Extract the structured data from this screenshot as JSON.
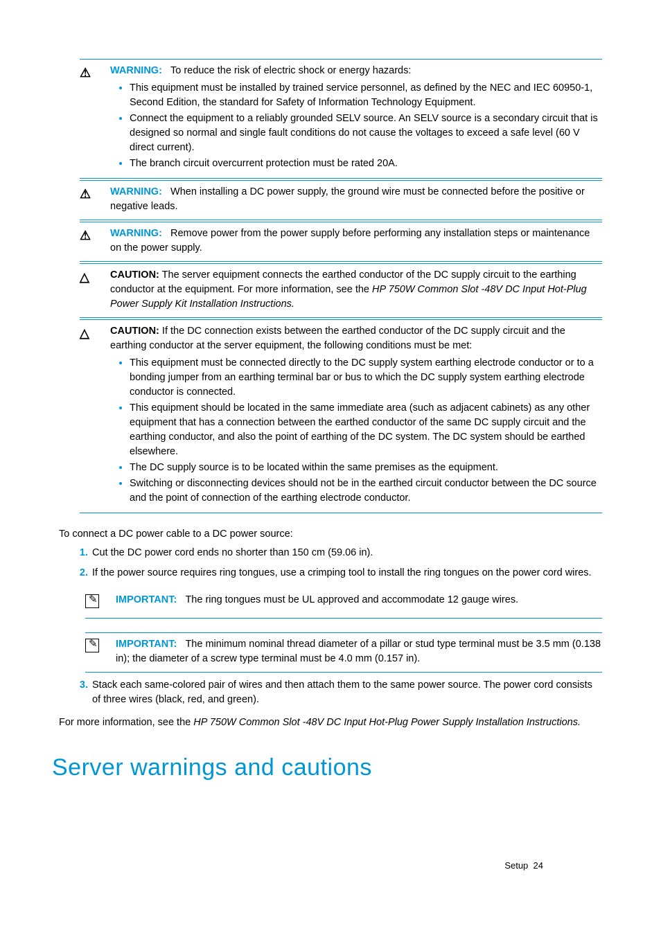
{
  "notices": [
    {
      "label": "WARNING:",
      "intro": "To reduce the risk of electric shock or energy hazards:",
      "bullets": [
        "This equipment must be installed by trained service personnel, as defined by the NEC and IEC 60950-1, Second Edition, the standard for Safety of Information Technology Equipment.",
        "Connect the equipment to a reliably grounded SELV source. An SELV source is a secondary circuit that is designed so normal and single fault conditions do not cause the voltages to exceed a safe level (60 V direct current).",
        "The branch circuit overcurrent protection must be rated 20A."
      ]
    },
    {
      "label": "WARNING:",
      "text": "When installing a DC power supply, the ground wire must be connected before the positive or negative leads."
    },
    {
      "label": "WARNING:",
      "text": "Remove power from the power supply before performing any installation steps or maintenance on the power supply."
    },
    {
      "label": "CAUTION:",
      "text_pre": "The server equipment connects the earthed conductor of the DC supply circuit to the earthing conductor at the equipment. For more information, see the ",
      "text_italic": "HP 750W Common Slot -48V DC Input Hot-Plug Power Supply Kit Installation Instructions.",
      "black": true
    },
    {
      "label": "CAUTION:",
      "intro": "If the DC connection exists between the earthed conductor of the DC supply circuit and the earthing conductor at the server equipment, the following conditions must be met:",
      "black": true,
      "bullets": [
        "This equipment must be connected directly to the DC supply system earthing electrode conductor or to a bonding jumper from an earthing terminal bar or bus to which the DC supply system earthing electrode conductor is connected.",
        "This equipment should be located in the same immediate area (such as adjacent cabinets) as any other equipment that has a connection between the earthed conductor of the same DC supply circuit and the earthing conductor, and also the point of earthing of the DC system. The DC system should be earthed elsewhere.",
        "The DC supply source is to be located within the same premises as the equipment.",
        "Switching or disconnecting devices should not be in the earthed circuit conductor between the DC source and the point of connection of the earthing electrode conductor."
      ]
    }
  ],
  "steps_intro": "To connect a DC power cable to a DC power source:",
  "steps": {
    "s1": "Cut the DC power cord ends no shorter than 150 cm (59.06 in).",
    "s2": "If the power source requires ring tongues, use a crimping tool to install the ring tongues on the power cord wires.",
    "s3": "Stack each same-colored pair of wires and then attach them to the same power source. The power cord consists of three wires (black, red, and green)."
  },
  "important": {
    "label": "IMPORTANT:",
    "i1": "The ring tongues must be UL approved and accommodate 12 gauge wires.",
    "i2": "The minimum nominal thread diameter of a pillar or stud type terminal must be 3.5 mm (0.138 in); the diameter of a screw type terminal must be 4.0 mm (0.157 in)."
  },
  "more_info_pre": "For more information, see the ",
  "more_info_italic": "HP 750W Common Slot -48V DC Input Hot-Plug Power Supply Installation Instructions.",
  "heading": "Server warnings and cautions",
  "footer_section": "Setup",
  "footer_page": "24"
}
